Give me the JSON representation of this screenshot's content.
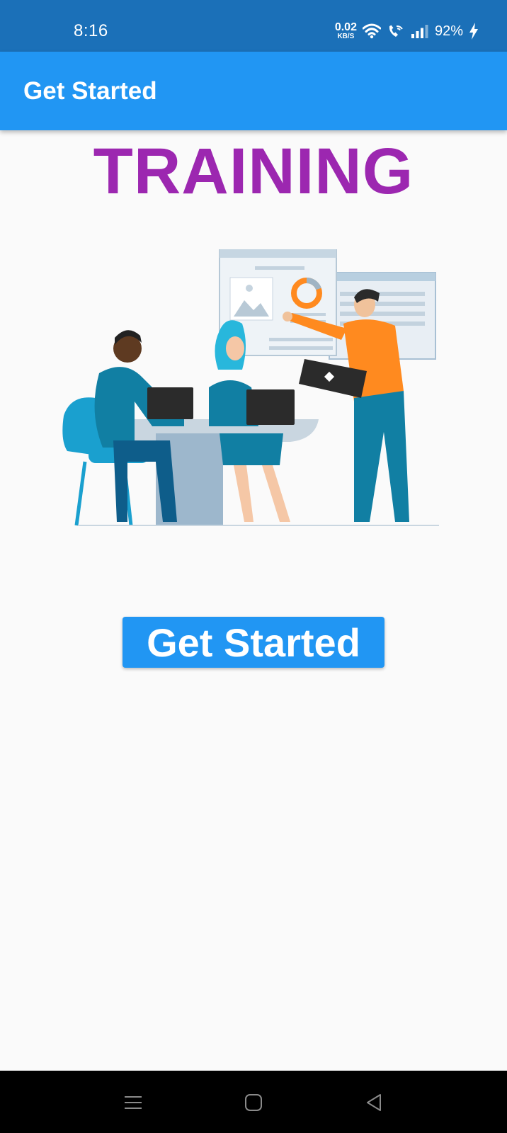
{
  "status_bar": {
    "time": "8:16",
    "net_speed_value": "0.02",
    "net_speed_unit": "KB/S",
    "battery": "92%",
    "icons": [
      "wifi-icon",
      "wifi-calling-icon",
      "signal-icon",
      "charging-icon"
    ]
  },
  "app_bar": {
    "title": "Get Started"
  },
  "main": {
    "headline": "TRAINING",
    "illustration": "training-illustration",
    "cta_label": "Get Started"
  },
  "nav_bar": {
    "buttons": [
      "menu-icon",
      "home-icon",
      "back-icon"
    ]
  },
  "colors": {
    "status_bar": "#1b70b8",
    "app_bar": "#2196f3",
    "headline": "#9c27b0",
    "button": "#2196f3",
    "background": "#fafafa"
  }
}
